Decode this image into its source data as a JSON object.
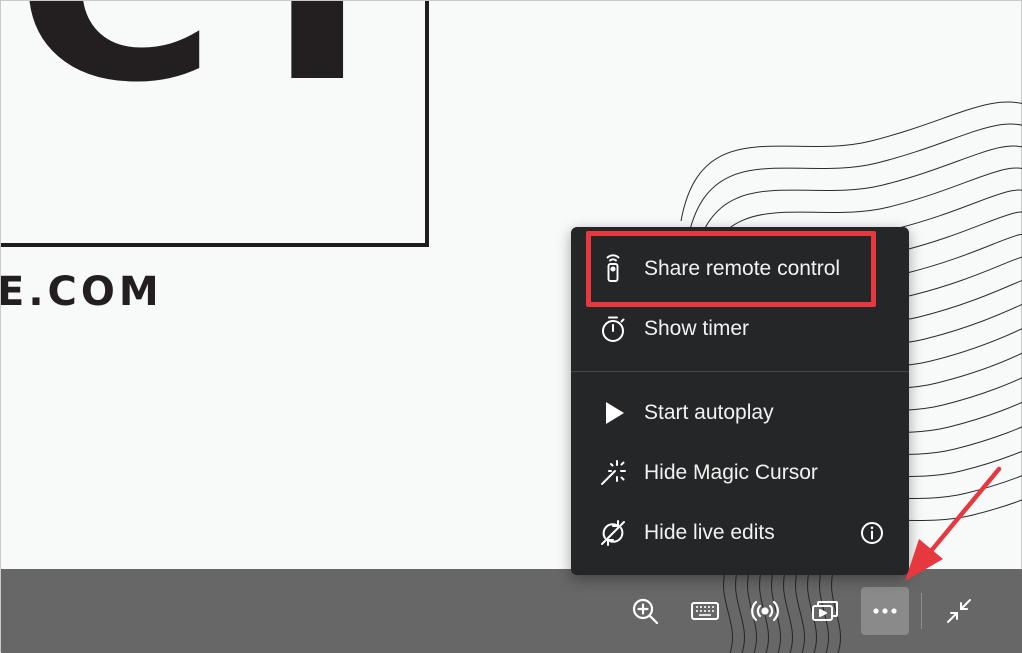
{
  "slide": {
    "title_text": "CT",
    "domain_text": "E.COM"
  },
  "menu": {
    "items": [
      {
        "label": "Share remote control",
        "icon": "remote-control-icon"
      },
      {
        "label": "Show timer",
        "icon": "stopwatch-icon"
      },
      {
        "label": "Start autoplay",
        "icon": "play-icon"
      },
      {
        "label": "Hide Magic Cursor",
        "icon": "magic-wand-icon"
      },
      {
        "label": "Hide live edits",
        "icon": "live-edits-off-icon",
        "trailing_icon": "info-icon"
      }
    ]
  },
  "toolbar": {
    "buttons": [
      "zoom-in-icon",
      "keyboard-icon",
      "broadcast-icon",
      "present-screen-icon",
      "more-options-icon",
      "exit-fullscreen-icon"
    ]
  },
  "colors": {
    "menu_background": "#252627",
    "toolbar_background": "#676767",
    "highlight": "#e8383f",
    "arrow": "#e8383f"
  }
}
